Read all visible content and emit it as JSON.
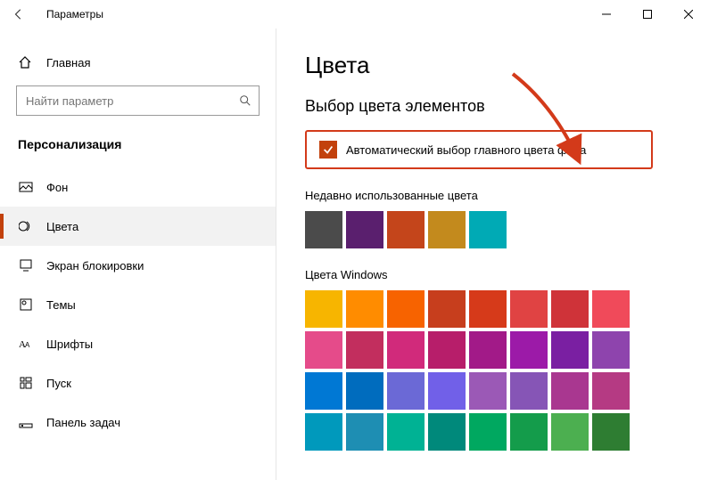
{
  "window": {
    "title": "Параметры"
  },
  "sidebar": {
    "home": "Главная",
    "search_placeholder": "Найти параметр",
    "section": "Персонализация",
    "items": [
      {
        "label": "Фон"
      },
      {
        "label": "Цвета"
      },
      {
        "label": "Экран блокировки"
      },
      {
        "label": "Темы"
      },
      {
        "label": "Шрифты"
      },
      {
        "label": "Пуск"
      },
      {
        "label": "Панель задач"
      }
    ]
  },
  "content": {
    "heading": "Цвета",
    "subheading": "Выбор цвета элементов",
    "auto_color_label": "Автоматический выбор главного цвета фона",
    "recent_label": "Недавно использованные цвета",
    "recent_colors": [
      "#4b4b4b",
      "#5a1f6e",
      "#c4451b",
      "#c38a1d",
      "#00aab5"
    ],
    "windows_colors_label": "Цвета Windows",
    "windows_colors": [
      [
        "#f7b500",
        "#ff8c00",
        "#f76300",
        "#c73e1d",
        "#d63a1a",
        "#e04343",
        "#cf3339",
        "#f04a5a"
      ],
      [
        "#e54b8a",
        "#c22e5e",
        "#d12a7b",
        "#b71e6a",
        "#a21a88",
        "#9c1aa8",
        "#7a1fa2",
        "#8e44ad"
      ],
      [
        "#0078d4",
        "#006cbe",
        "#6b69d6",
        "#7160e8",
        "#9b59b6",
        "#8655b6",
        "#a93790",
        "#b53a83"
      ],
      [
        "#0099bc",
        "#1e8eb3",
        "#00b294",
        "#00897b",
        "#00a860",
        "#149c4b",
        "#4caf50",
        "#2e7d32"
      ]
    ]
  }
}
